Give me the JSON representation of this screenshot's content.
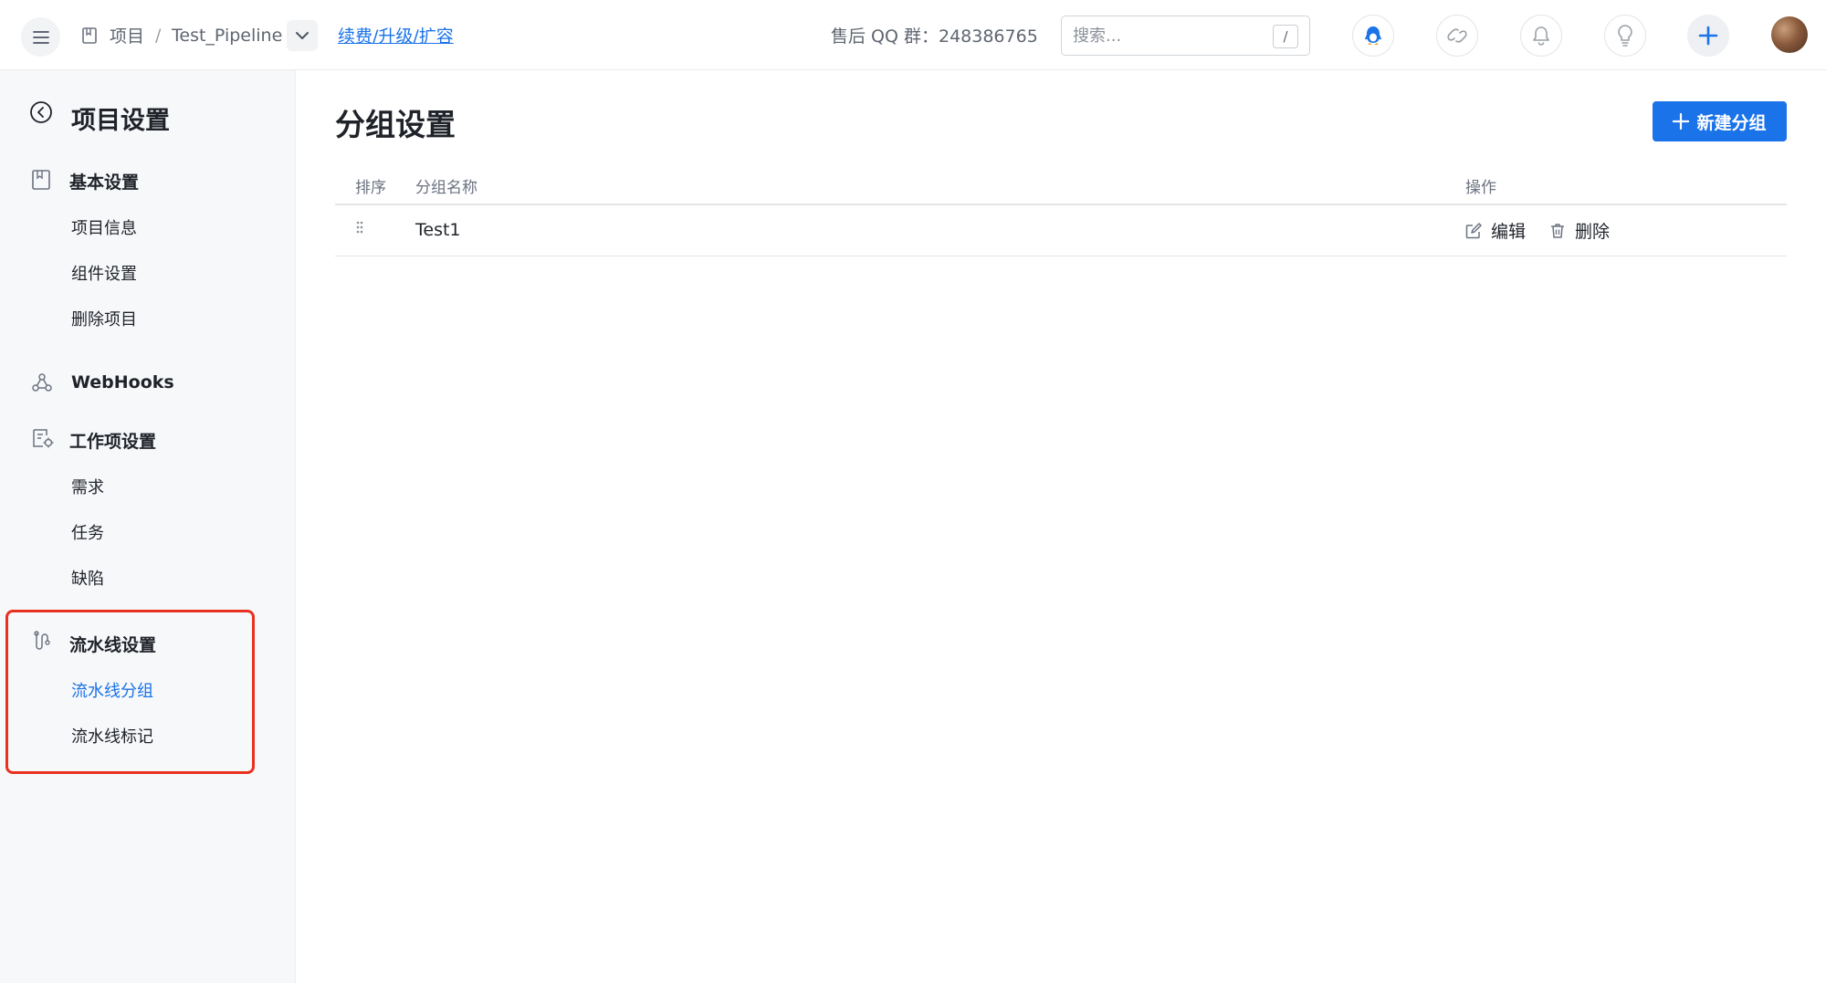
{
  "header": {
    "breadcrumb": {
      "project": "项目",
      "separator": "/",
      "name": "Test_Pipeline"
    },
    "renew_link": "续费/升级/扩容",
    "qq_group": "售后 QQ 群：248386765",
    "search": {
      "placeholder": "搜索...",
      "shortcut": "/"
    },
    "icons": [
      "menu-icon",
      "project-icon",
      "chevron-down-icon",
      "penguin-icon",
      "link-icon",
      "bell-icon",
      "lightbulb-icon",
      "plus-icon"
    ]
  },
  "sidebar": {
    "title": "项目设置",
    "groups": [
      {
        "label": "基本设置",
        "icon": "book-icon",
        "items": [
          "项目信息",
          "组件设置",
          "删除项目"
        ]
      },
      {
        "label": "WebHooks",
        "icon": "webhooks-icon",
        "items": []
      },
      {
        "label": "工作项设置",
        "icon": "workitem-settings-icon",
        "items": [
          "需求",
          "任务",
          "缺陷"
        ]
      },
      {
        "label": "流水线设置",
        "icon": "pipeline-icon",
        "items": [
          "流水线分组",
          "流水线标记"
        ]
      }
    ],
    "active_item": "流水线分组"
  },
  "main": {
    "title": "分组设置",
    "new_button": "新建分组",
    "table": {
      "columns": [
        "排序",
        "分组名称",
        "操作"
      ],
      "rows": [
        {
          "name": "Test1",
          "actions": [
            "编辑",
            "删除"
          ]
        }
      ]
    }
  },
  "colors": {
    "accent": "#1a73e8",
    "highlight": "#e8321f",
    "sidebar_bg": "#f7f8fa"
  }
}
